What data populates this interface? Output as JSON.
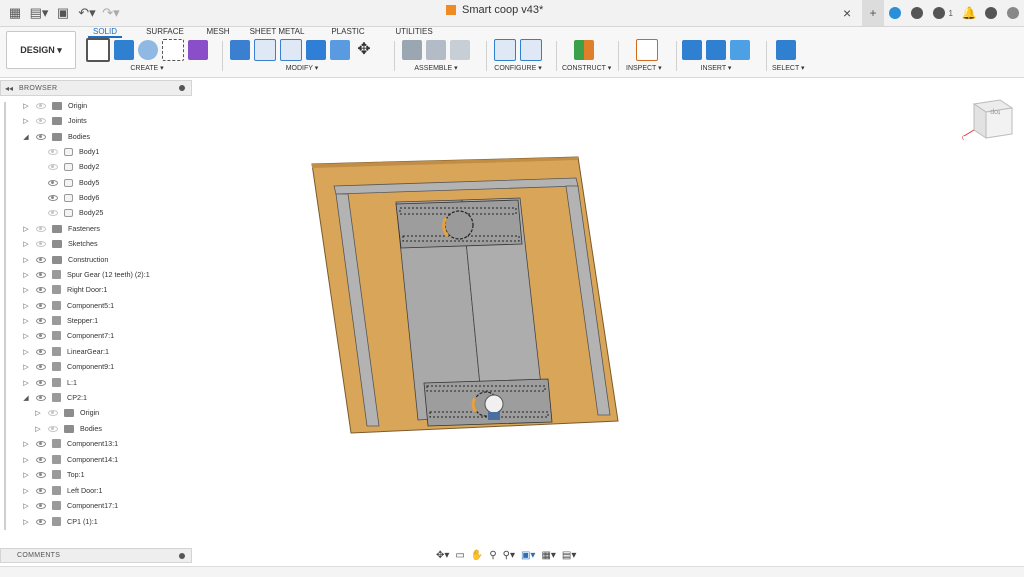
{
  "titlebar": {
    "document_title": "Smart coop v43*",
    "icons": [
      "grid-icon",
      "file-icon",
      "save-icon",
      "undo-icon",
      "redo-icon"
    ],
    "right_icons": [
      "add-tab-icon",
      "extensions-icon",
      "jobs-icon",
      "notifications-count-icon",
      "bell-icon",
      "help-icon",
      "user-icon"
    ],
    "notification_count": "1"
  },
  "workspace": {
    "design_label": "DESIGN ▾"
  },
  "tabs": [
    "SOLID",
    "SURFACE",
    "MESH",
    "SHEET METAL",
    "PLASTIC",
    "UTILITIES"
  ],
  "groups": [
    {
      "label": "CREATE ▾"
    },
    {
      "label": "MODIFY ▾"
    },
    {
      "label": "ASSEMBLE ▾"
    },
    {
      "label": "CONFIGURE ▾"
    },
    {
      "label": "CONSTRUCT ▾"
    },
    {
      "label": "INSPECT ▾"
    },
    {
      "label": "INSERT ▾"
    },
    {
      "label": "SELECT ▾"
    }
  ],
  "browser": {
    "title": "BROWSER",
    "items": [
      {
        "label": "Origin",
        "icon": "folder"
      },
      {
        "label": "Joints",
        "icon": "folder"
      },
      {
        "label": "Bodies",
        "icon": "folder"
      },
      {
        "label": "Body1",
        "icon": "body"
      },
      {
        "label": "Body2",
        "icon": "body"
      },
      {
        "label": "Body5",
        "icon": "body"
      },
      {
        "label": "Body6",
        "icon": "body"
      },
      {
        "label": "Body25",
        "icon": "body"
      },
      {
        "label": "Fasteners",
        "icon": "folder"
      },
      {
        "label": "Sketches",
        "icon": "folder"
      },
      {
        "label": "Construction",
        "icon": "folder"
      },
      {
        "label": "Spur Gear (12 teeth) (2):1",
        "icon": "component"
      },
      {
        "label": "Right Door:1",
        "icon": "component"
      },
      {
        "label": "Component5:1",
        "icon": "component"
      },
      {
        "label": "Stepper:1",
        "icon": "component"
      },
      {
        "label": "Component7:1",
        "icon": "component"
      },
      {
        "label": "LinearGear:1",
        "icon": "component"
      },
      {
        "label": "Component9:1",
        "icon": "component"
      },
      {
        "label": "L:1",
        "icon": "component"
      },
      {
        "label": "CP2:1",
        "icon": "component"
      },
      {
        "label": "Origin",
        "icon": "folder"
      },
      {
        "label": "Bodies",
        "icon": "folder"
      },
      {
        "label": "Component13:1",
        "icon": "component"
      },
      {
        "label": "Component14:1",
        "icon": "component"
      },
      {
        "label": "Top:1",
        "icon": "component"
      },
      {
        "label": "Left Door:1",
        "icon": "component"
      },
      {
        "label": "Component17:1",
        "icon": "component"
      },
      {
        "label": "CP1 (1):1",
        "icon": "component"
      }
    ]
  },
  "comments": {
    "title": "COMMENTS"
  },
  "viewcube": {
    "face_label": "top"
  },
  "colors": {
    "accent": "#1b6ec2",
    "wood": "#d9a659",
    "metal": "#a9a9a9"
  }
}
